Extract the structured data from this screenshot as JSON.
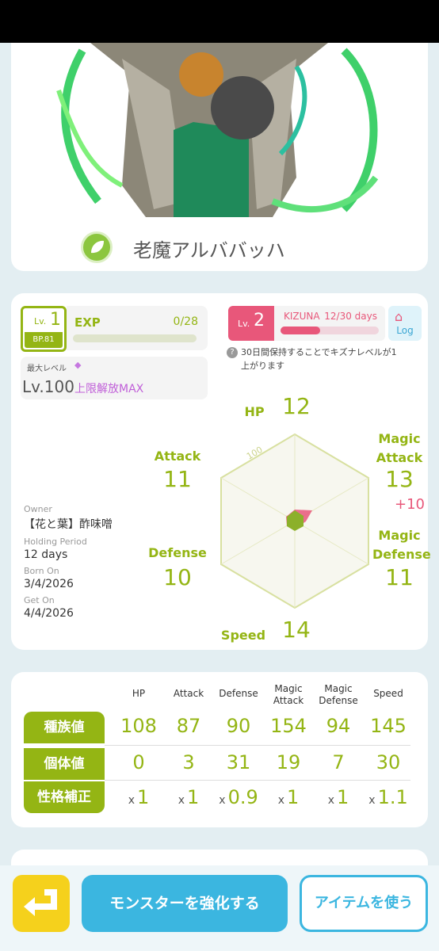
{
  "monster": {
    "name": "老魔アルババッハ",
    "element_icon": "leaf-icon"
  },
  "level": {
    "prefix": "Lv.",
    "value": "1",
    "bp": "BP.81",
    "exp_label": "EXP",
    "exp_value": "0/28",
    "max_level_label": "最大レベル",
    "max_level_value": "Lv.100",
    "limit_break": "上限解放MAX"
  },
  "kizuna": {
    "prefix": "Lv.",
    "level": "2",
    "label": "KIZUNA",
    "value": "12/30 days",
    "progress": 0.4,
    "log_label": "Log",
    "note": "30日間保持することでキズナレベルが1上がります"
  },
  "owner": {
    "owner_label": "Owner",
    "owner_value": "【花と葉】酢味噌",
    "holding_label": "Holding Period",
    "holding_value": "12 days",
    "born_label": "Born On",
    "born_value": "3/4/2026",
    "get_label": "Get On",
    "get_value": "4/4/2026"
  },
  "radar": {
    "scale_label": "100",
    "hp_label": "HP",
    "hp_value": "12",
    "attack_label": "Attack",
    "attack_value": "11",
    "defense_label": "Defense",
    "defense_value": "10",
    "speed_label": "Speed",
    "speed_value": "14",
    "mattack_label": "Magic\nAttack",
    "mattack_value": "13",
    "mattack_bonus": "+10",
    "mdefense_label": "Magic\nDefense",
    "mdefense_value": "11"
  },
  "table": {
    "columns": [
      "HP",
      "Attack",
      "Defense",
      "Magic\nAttack",
      "Magic\nDefense",
      "Speed"
    ],
    "rows": [
      {
        "label": "種族値",
        "values": [
          "108",
          "87",
          "90",
          "154",
          "94",
          "145"
        ]
      },
      {
        "label": "個体値",
        "values": [
          "0",
          "3",
          "31",
          "19",
          "7",
          "30"
        ]
      },
      {
        "label": "性格補正",
        "mult": "x",
        "values": [
          "1",
          "1",
          "0.9",
          "1",
          "1",
          "1.1"
        ]
      }
    ]
  },
  "buttons": {
    "enhance": "モンスターを強化する",
    "use_item": "アイテムを使う"
  },
  "colors": {
    "accent_green": "#94b514",
    "accent_pink": "#e8577a",
    "accent_blue": "#3bb6e0"
  }
}
